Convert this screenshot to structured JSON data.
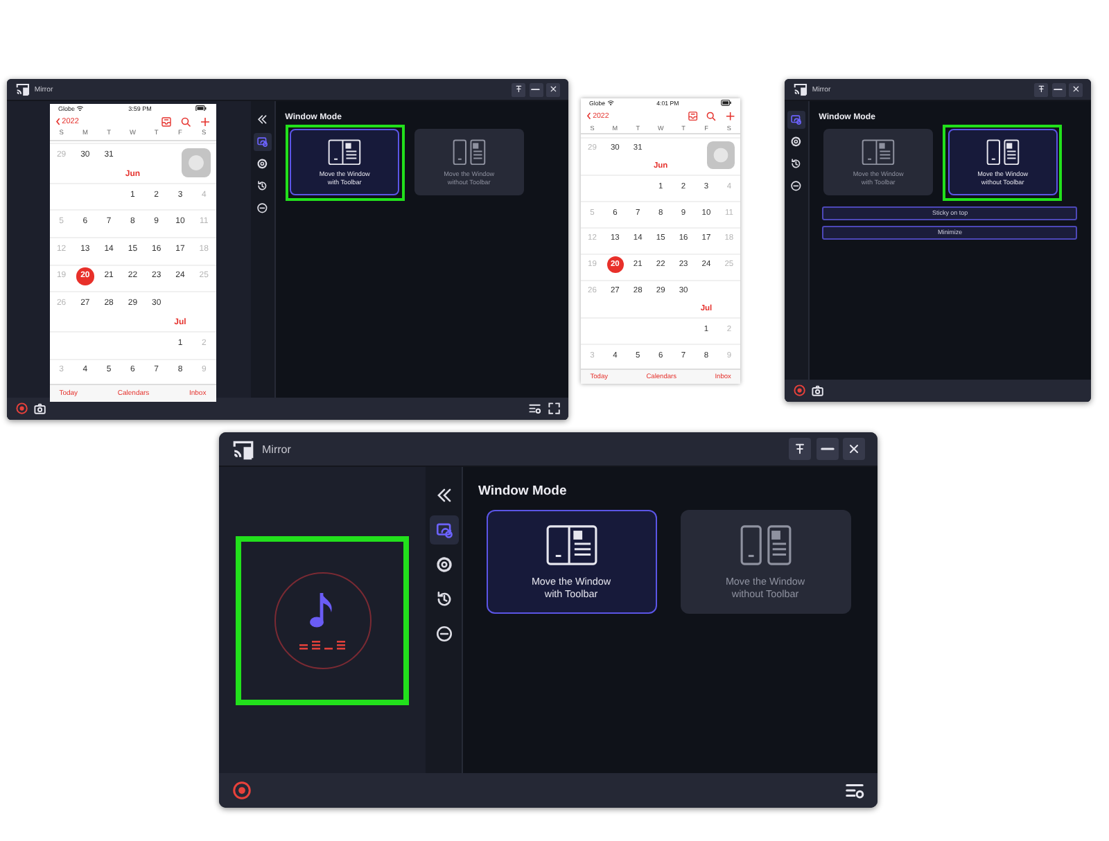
{
  "panels": [
    {
      "kind": "window",
      "title": "Mirror",
      "title_buttons": [
        {
          "kind": "pin"
        },
        {
          "kind": "minimize"
        },
        {
          "kind": "close"
        }
      ],
      "preview": {
        "kind": "phone",
        "calendar": {
          "carrier": "Globe",
          "time": "3:59 PM",
          "year": "2022",
          "weekdays": [
            "S",
            "M",
            "T",
            "W",
            "T",
            "F",
            "S"
          ],
          "rows": [
            {
              "kind": "week",
              "days": [
                {
                  "kind": "sun",
                  "text": "29",
                  "today": false
                },
                {
                  "kind": "mon",
                  "text": "30",
                  "today": false
                },
                {
                  "kind": "tue",
                  "text": "31",
                  "today": false
                }
              ]
            },
            {
              "kind": "week",
              "month": "Jun",
              "days": [
                {
                  "kind": "wed",
                  "text": "1",
                  "today": false
                },
                {
                  "kind": "thu",
                  "text": "2",
                  "today": false
                },
                {
                  "kind": "fri",
                  "text": "3",
                  "today": false
                },
                {
                  "kind": "sat",
                  "text": "4",
                  "today": false
                }
              ]
            },
            {
              "kind": "week",
              "days": [
                {
                  "kind": "sun",
                  "text": "5",
                  "today": false
                },
                {
                  "kind": "mon",
                  "text": "6",
                  "today": false
                },
                {
                  "kind": "tue",
                  "text": "7",
                  "today": false
                },
                {
                  "kind": "wed",
                  "text": "8",
                  "today": false
                },
                {
                  "kind": "thu",
                  "text": "9",
                  "today": false
                },
                {
                  "kind": "fri",
                  "text": "10",
                  "today": false
                },
                {
                  "kind": "sat",
                  "text": "11",
                  "today": false
                }
              ]
            },
            {
              "kind": "week",
              "days": [
                {
                  "kind": "sun",
                  "text": "12",
                  "today": false
                },
                {
                  "kind": "mon",
                  "text": "13",
                  "today": false
                },
                {
                  "kind": "tue",
                  "text": "14",
                  "today": false
                },
                {
                  "kind": "wed",
                  "text": "15",
                  "today": false
                },
                {
                  "kind": "thu",
                  "text": "16",
                  "today": false
                },
                {
                  "kind": "fri",
                  "text": "17",
                  "today": false
                },
                {
                  "kind": "sat",
                  "text": "18",
                  "today": false
                }
              ]
            },
            {
              "kind": "week",
              "days": [
                {
                  "kind": "sun",
                  "text": "19",
                  "today": false
                },
                {
                  "kind": "mon",
                  "text": "20",
                  "today": true
                },
                {
                  "kind": "tue",
                  "text": "21",
                  "today": false
                },
                {
                  "kind": "wed",
                  "text": "22",
                  "today": false
                },
                {
                  "kind": "thu",
                  "text": "23",
                  "today": false
                },
                {
                  "kind": "fri",
                  "text": "24",
                  "today": false
                },
                {
                  "kind": "sat",
                  "text": "25",
                  "today": false
                }
              ]
            },
            {
              "kind": "week",
              "days": [
                {
                  "kind": "sun",
                  "text": "26",
                  "today": false
                },
                {
                  "kind": "mon",
                  "text": "27",
                  "today": false
                },
                {
                  "kind": "tue",
                  "text": "28",
                  "today": false
                },
                {
                  "kind": "wed",
                  "text": "29",
                  "today": false
                },
                {
                  "kind": "thu",
                  "text": "30",
                  "today": false
                }
              ]
            },
            {
              "kind": "week",
              "month": "Jul",
              "days": [
                {
                  "kind": "fri",
                  "text": "1",
                  "today": false
                },
                {
                  "kind": "sat",
                  "text": "2",
                  "today": false
                }
              ]
            },
            {
              "kind": "week",
              "days": [
                {
                  "kind": "sun",
                  "text": "3",
                  "today": false
                },
                {
                  "kind": "mon",
                  "text": "4",
                  "today": false
                },
                {
                  "kind": "tue",
                  "text": "5",
                  "today": false
                },
                {
                  "kind": "wed",
                  "text": "6",
                  "today": false
                },
                {
                  "kind": "thu",
                  "text": "7",
                  "today": false
                },
                {
                  "kind": "fri",
                  "text": "8",
                  "today": false
                },
                {
                  "kind": "sat",
                  "text": "9",
                  "today": false
                }
              ]
            }
          ],
          "tabs": [
            "Today",
            "Calendars",
            "Inbox"
          ]
        }
      },
      "sidebar": [
        {
          "kind": "collapse",
          "selected": false
        },
        {
          "kind": "mirror",
          "selected": true
        },
        {
          "kind": "settings",
          "selected": false
        },
        {
          "kind": "history",
          "selected": false
        },
        {
          "kind": "minus",
          "selected": false
        }
      ],
      "section_title": "Window Mode",
      "cards": [
        {
          "kind": "joined",
          "label": "Move the Window\nwith Toolbar",
          "selected": true,
          "highlighted": true
        },
        {
          "kind": "separate",
          "label": "Move the Window\nwithout Toolbar",
          "selected": false,
          "highlighted": false
        }
      ],
      "toolbar_left": [
        {
          "kind": "record"
        },
        {
          "kind": "camera"
        }
      ],
      "toolbar_right": [
        {
          "kind": "list-settings"
        },
        {
          "kind": "fullscreen"
        }
      ]
    },
    {
      "kind": "phone",
      "calendar": {
        "carrier": "Globe",
        "time": "4:01 PM",
        "year": "2022",
        "weekdays": [
          "S",
          "M",
          "T",
          "W",
          "T",
          "F",
          "S"
        ],
        "rows": [
          {
            "kind": "week",
            "days": [
              {
                "kind": "sun",
                "text": "29",
                "today": false
              },
              {
                "kind": "mon",
                "text": "30",
                "today": false
              },
              {
                "kind": "tue",
                "text": "31",
                "today": false
              }
            ]
          },
          {
            "kind": "week",
            "month": "Jun",
            "days": [
              {
                "kind": "wed",
                "text": "1",
                "today": false
              },
              {
                "kind": "thu",
                "text": "2",
                "today": false
              },
              {
                "kind": "fri",
                "text": "3",
                "today": false
              },
              {
                "kind": "sat",
                "text": "4",
                "today": false
              }
            ]
          },
          {
            "kind": "week",
            "days": [
              {
                "kind": "sun",
                "text": "5",
                "today": false
              },
              {
                "kind": "mon",
                "text": "6",
                "today": false
              },
              {
                "kind": "tue",
                "text": "7",
                "today": false
              },
              {
                "kind": "wed",
                "text": "8",
                "today": false
              },
              {
                "kind": "thu",
                "text": "9",
                "today": false
              },
              {
                "kind": "fri",
                "text": "10",
                "today": false
              },
              {
                "kind": "sat",
                "text": "11",
                "today": false
              }
            ]
          },
          {
            "kind": "week",
            "days": [
              {
                "kind": "sun",
                "text": "12",
                "today": false
              },
              {
                "kind": "mon",
                "text": "13",
                "today": false
              },
              {
                "kind": "tue",
                "text": "14",
                "today": false
              },
              {
                "kind": "wed",
                "text": "15",
                "today": false
              },
              {
                "kind": "thu",
                "text": "16",
                "today": false
              },
              {
                "kind": "fri",
                "text": "17",
                "today": false
              },
              {
                "kind": "sat",
                "text": "18",
                "today": false
              }
            ]
          },
          {
            "kind": "week",
            "days": [
              {
                "kind": "sun",
                "text": "19",
                "today": false
              },
              {
                "kind": "mon",
                "text": "20",
                "today": true
              },
              {
                "kind": "tue",
                "text": "21",
                "today": false
              },
              {
                "kind": "wed",
                "text": "22",
                "today": false
              },
              {
                "kind": "thu",
                "text": "23",
                "today": false
              },
              {
                "kind": "fri",
                "text": "24",
                "today": false
              },
              {
                "kind": "sat",
                "text": "25",
                "today": false
              }
            ]
          },
          {
            "kind": "week",
            "days": [
              {
                "kind": "sun",
                "text": "26",
                "today": false
              },
              {
                "kind": "mon",
                "text": "27",
                "today": false
              },
              {
                "kind": "tue",
                "text": "28",
                "today": false
              },
              {
                "kind": "wed",
                "text": "29",
                "today": false
              },
              {
                "kind": "thu",
                "text": "30",
                "today": false
              }
            ]
          },
          {
            "kind": "week",
            "month": "Jul",
            "days": [
              {
                "kind": "fri",
                "text": "1",
                "today": false
              },
              {
                "kind": "sat",
                "text": "2",
                "today": false
              }
            ]
          },
          {
            "kind": "week",
            "days": [
              {
                "kind": "sun",
                "text": "3",
                "today": false
              },
              {
                "kind": "mon",
                "text": "4",
                "today": false
              },
              {
                "kind": "tue",
                "text": "5",
                "today": false
              },
              {
                "kind": "wed",
                "text": "6",
                "today": false
              },
              {
                "kind": "thu",
                "text": "7",
                "today": false
              },
              {
                "kind": "fri",
                "text": "8",
                "today": false
              },
              {
                "kind": "sat",
                "text": "9",
                "today": false
              }
            ]
          }
        ],
        "tabs": [
          "Today",
          "Calendars",
          "Inbox"
        ]
      }
    },
    {
      "kind": "window",
      "title": "Mirror",
      "title_buttons": [
        {
          "kind": "pin"
        },
        {
          "kind": "minimize"
        },
        {
          "kind": "close"
        }
      ],
      "sidebar": [
        {
          "kind": "mirror",
          "selected": true
        },
        {
          "kind": "settings",
          "selected": false
        },
        {
          "kind": "history",
          "selected": false
        },
        {
          "kind": "minus",
          "selected": false
        }
      ],
      "section_title": "Window Mode",
      "cards": [
        {
          "kind": "joined",
          "label": "Move the Window\nwith Toolbar",
          "selected": false,
          "highlighted": false
        },
        {
          "kind": "separate",
          "label": "Move the Window\nwithout Toolbar",
          "selected": true,
          "highlighted": true
        }
      ],
      "buttons": [
        "Sticky on top",
        "Minimize"
      ],
      "toolbar_left": [
        {
          "kind": "record"
        },
        {
          "kind": "camera"
        }
      ]
    },
    {
      "kind": "window",
      "title": "Mirror",
      "title_buttons": [
        {
          "kind": "pin"
        },
        {
          "kind": "minimize"
        },
        {
          "kind": "close"
        }
      ],
      "preview": {
        "kind": "audio",
        "highlighted": true
      },
      "sidebar": [
        {
          "kind": "collapse",
          "selected": false
        },
        {
          "kind": "mirror",
          "selected": true
        },
        {
          "kind": "settings",
          "selected": false
        },
        {
          "kind": "history",
          "selected": false
        },
        {
          "kind": "minus",
          "selected": false
        }
      ],
      "section_title": "Window Mode",
      "cards": [
        {
          "kind": "joined",
          "label": "Move the Window\nwith Toolbar",
          "selected": true,
          "highlighted": false
        },
        {
          "kind": "separate",
          "label": "Move the Window\nwithout Toolbar",
          "selected": false,
          "highlighted": false
        }
      ],
      "toolbar_left": [
        {
          "kind": "record"
        }
      ],
      "toolbar_right": [
        {
          "kind": "list-settings"
        }
      ]
    }
  ]
}
